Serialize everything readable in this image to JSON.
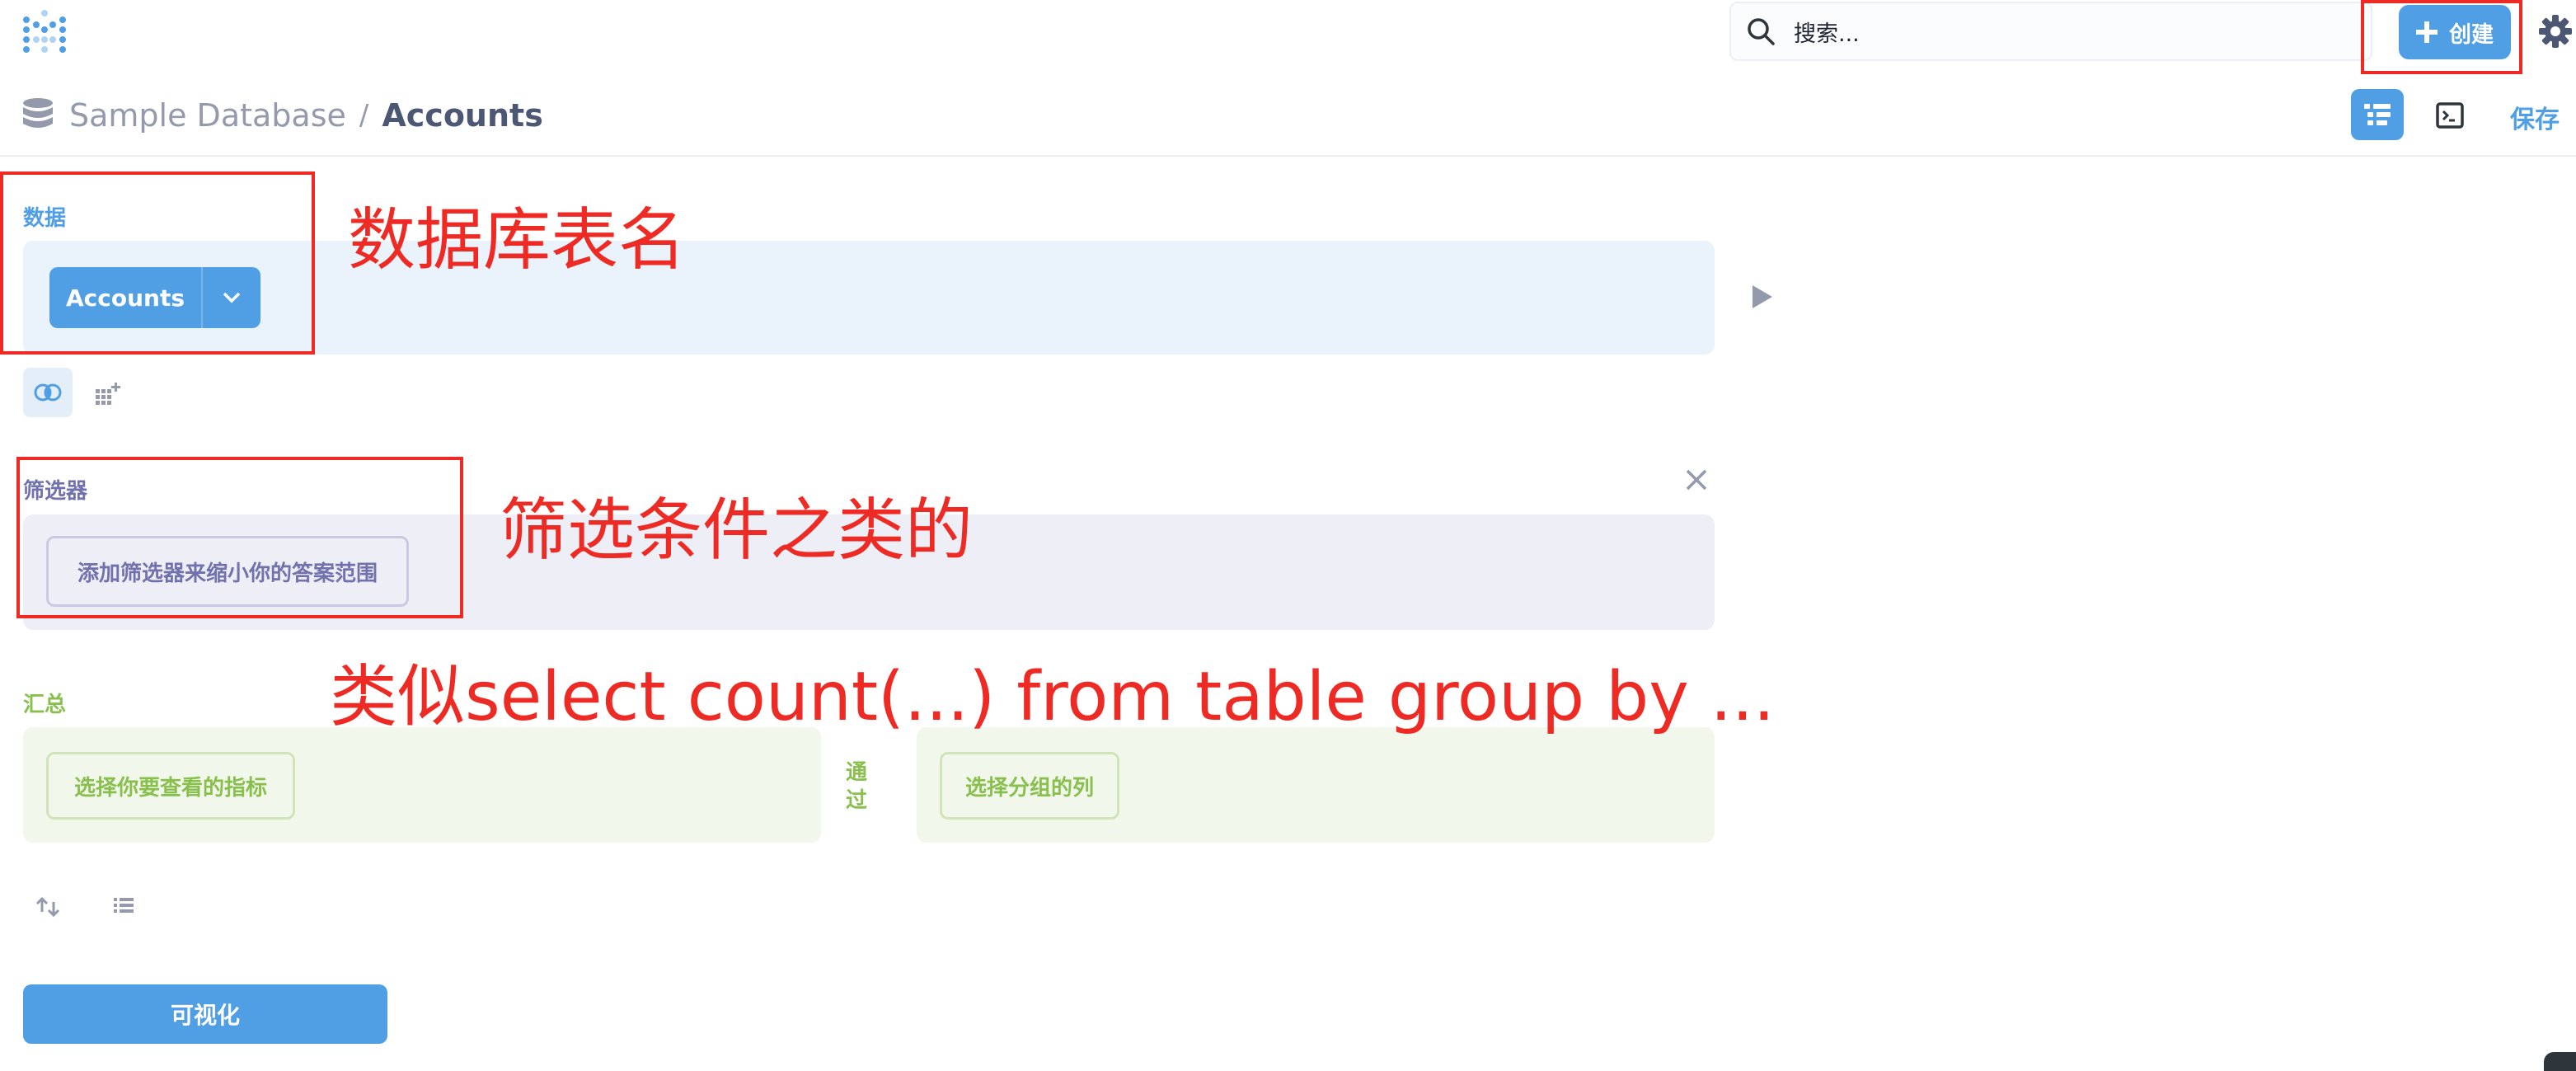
{
  "topbar": {
    "logo_icon": "metabase-logo-icon",
    "search": {
      "placeholder": "搜索..."
    },
    "create_label": "创建",
    "settings_icon": "gear-icon"
  },
  "breadcrumb": {
    "database": "Sample Database",
    "separator": "/",
    "table": "Accounts"
  },
  "header_actions": {
    "notebook_icon": "notebook-icon",
    "sql_icon": "console-icon",
    "save_label": "保存"
  },
  "data_section": {
    "label": "数据",
    "table_name": "Accounts",
    "run_icon": "play-icon"
  },
  "step_actions": {
    "join_icon": "join-icon",
    "custom_column_icon": "custom-column-icon"
  },
  "filter_section": {
    "label": "筛选器",
    "add_placeholder": "添加筛选器来缩小你的答案范围"
  },
  "summarize_section": {
    "label": "汇总",
    "metric_placeholder": "选择你要查看的指标",
    "by_label": "通过",
    "group_placeholder": "选择分组的列"
  },
  "footer_actions": {
    "sort_icon": "sort-icon",
    "limit_icon": "list-icon",
    "visualize_label": "可视化"
  },
  "annotations": {
    "data_note": "数据库表名",
    "filter_note": "筛选条件之类的",
    "summarize_note": "类似select count(...) from table group by ...",
    "color": "#ee2a24"
  },
  "colors": {
    "brand": "#509ee3",
    "filter": "#7172ad",
    "summarize": "#88bf4d"
  }
}
